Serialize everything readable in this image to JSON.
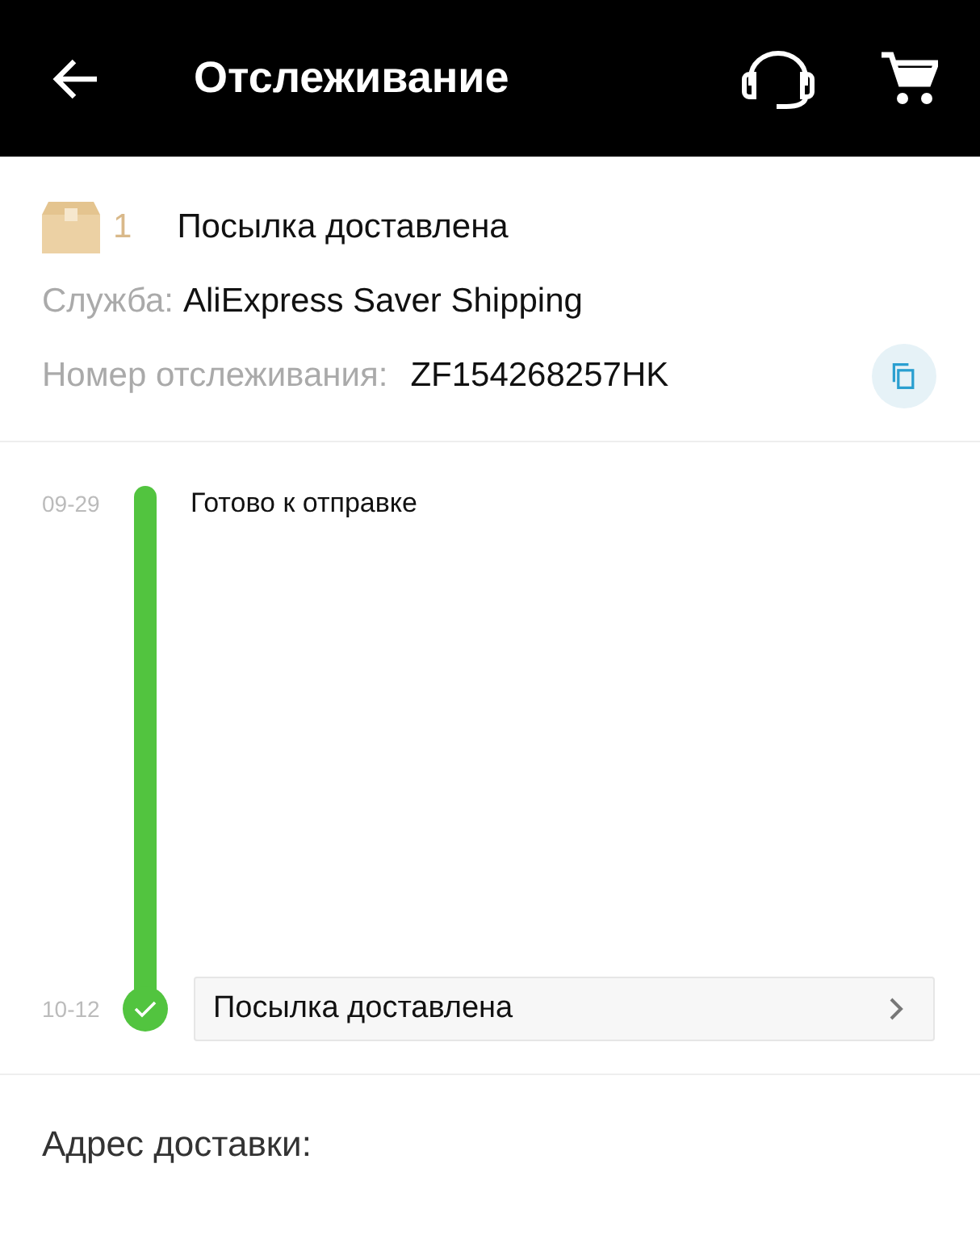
{
  "header": {
    "title": "Отслеживание"
  },
  "package": {
    "count": "1",
    "status": "Посылка доставлена",
    "service_label": "Служба:",
    "service": "AliExpress Saver Shipping",
    "tracking_label": "Номер отслеживания:",
    "tracking_number": "ZF154268257HK"
  },
  "timeline": [
    {
      "date": "09-29",
      "text": "Готово к отправке",
      "current": false
    },
    {
      "date": "10-12",
      "text": "Посылка доставлена",
      "current": true
    }
  ],
  "address": {
    "label": "Адрес доставки:"
  }
}
